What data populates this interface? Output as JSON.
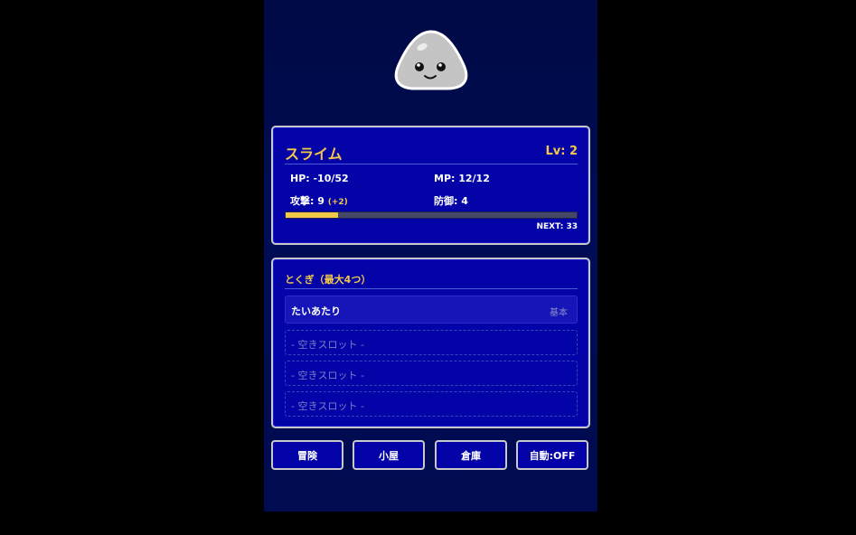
{
  "monster": {
    "name": "スライム",
    "level": "Lv: 2",
    "hp": "HP: -10/52",
    "mp": "MP: 12/12",
    "attack": "攻撃: 9",
    "attack_bonus": "(+2)",
    "defense": "防御: 4",
    "exp_progress": 0.18,
    "next": "NEXT: 33"
  },
  "skills": {
    "title": "とくぎ（最大4つ）",
    "slots": [
      {
        "label": "たいあたり",
        "tag": "基本"
      },
      {
        "label": "- 空きスロット -"
      },
      {
        "label": "- 空きスロット -"
      },
      {
        "label": "- 空きスロット -"
      }
    ]
  },
  "buttons": {
    "adventure": "冒険",
    "hut": "小屋",
    "storage": "倉庫",
    "auto": "自動:OFF"
  },
  "colors": {
    "background": "#000b50",
    "panel": "#0303a8",
    "accent": "#f2c84b",
    "border": "#c9c9c9"
  },
  "icons": {
    "avatar": "slime-icon"
  }
}
